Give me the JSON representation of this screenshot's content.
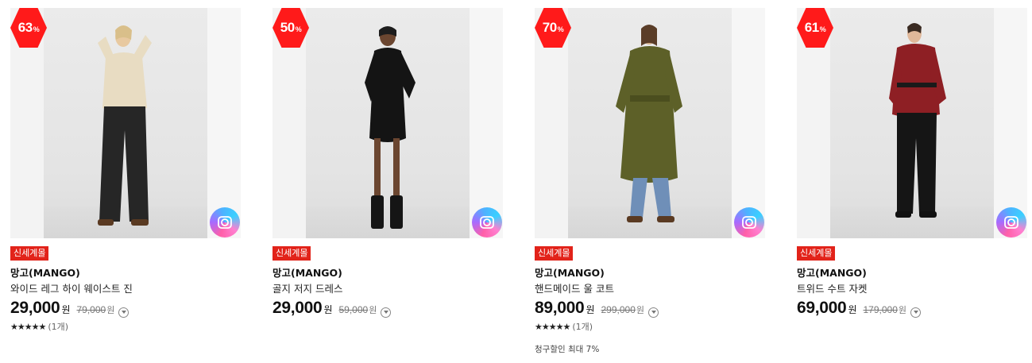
{
  "icons": {
    "image_search": "camera-lens-icon",
    "info": "chevron-down-circle-icon",
    "star": "star-icon"
  },
  "colors": {
    "discount_badge": "#ff1a1a",
    "store_tag": "#e2231a",
    "price": "#111111",
    "original_price": "#777777"
  },
  "products": [
    {
      "discount": "63",
      "discount_unit": "%",
      "store_tag": "신세계몰",
      "brand": "망고(MANGO)",
      "name": "와이드 레그 하이 웨이스트 진",
      "price": "29,000",
      "price_unit": "원",
      "original_price": "79,000",
      "original_unit": "원",
      "stars": "★★★★★",
      "review_count": "(1개)",
      "promo": ""
    },
    {
      "discount": "50",
      "discount_unit": "%",
      "store_tag": "신세계몰",
      "brand": "망고(MANGO)",
      "name": "골지 저지 드레스",
      "price": "29,000",
      "price_unit": "원",
      "original_price": "59,000",
      "original_unit": "원",
      "stars": "",
      "review_count": "",
      "promo": ""
    },
    {
      "discount": "70",
      "discount_unit": "%",
      "store_tag": "신세계몰",
      "brand": "망고(MANGO)",
      "name": "핸드메이드 울 코트",
      "price": "89,000",
      "price_unit": "원",
      "original_price": "299,000",
      "original_unit": "원",
      "stars": "★★★★★",
      "review_count": "(1개)",
      "promo": "청구할인 최대 7%"
    },
    {
      "discount": "61",
      "discount_unit": "%",
      "store_tag": "신세계몰",
      "brand": "망고(MANGO)",
      "name": "트위드 수트 자켓",
      "price": "69,000",
      "price_unit": "원",
      "original_price": "179,000",
      "original_unit": "원",
      "stars": "",
      "review_count": "",
      "promo": ""
    }
  ]
}
